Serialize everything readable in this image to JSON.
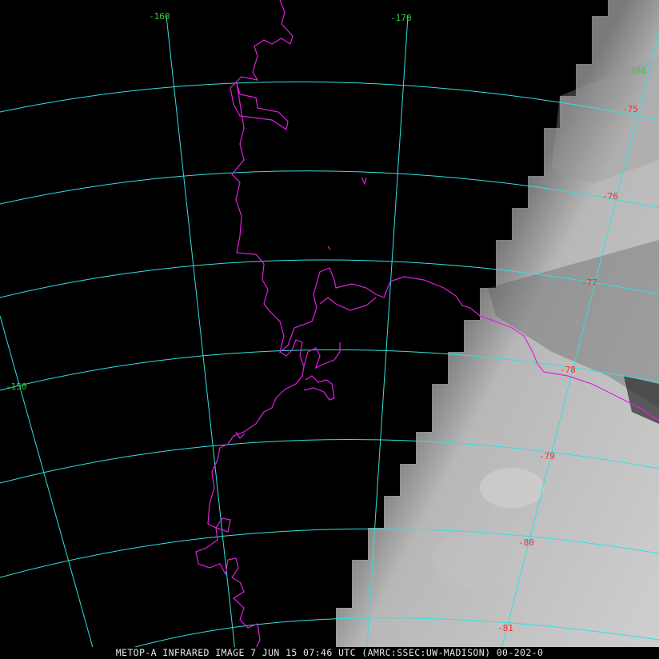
{
  "caption": "METOP-A INFRARED IMAGE 7 JUN 15 07:46 UTC (AMRC:SSEC:UW-MADISON) 00-202-0",
  "longitude_labels": [
    "-160",
    "-170",
    "180",
    "-150"
  ],
  "latitude_labels": [
    "-75",
    "-76",
    "-77",
    "-78",
    "-79",
    "-80",
    "-81"
  ],
  "colors": {
    "background": "#000000",
    "graticule": "#33e0e0",
    "coastline": "#e020e0",
    "longitude_label": "#30d030",
    "latitude_label": "#ff2a2a",
    "caption_text": "#e6e6e6"
  }
}
